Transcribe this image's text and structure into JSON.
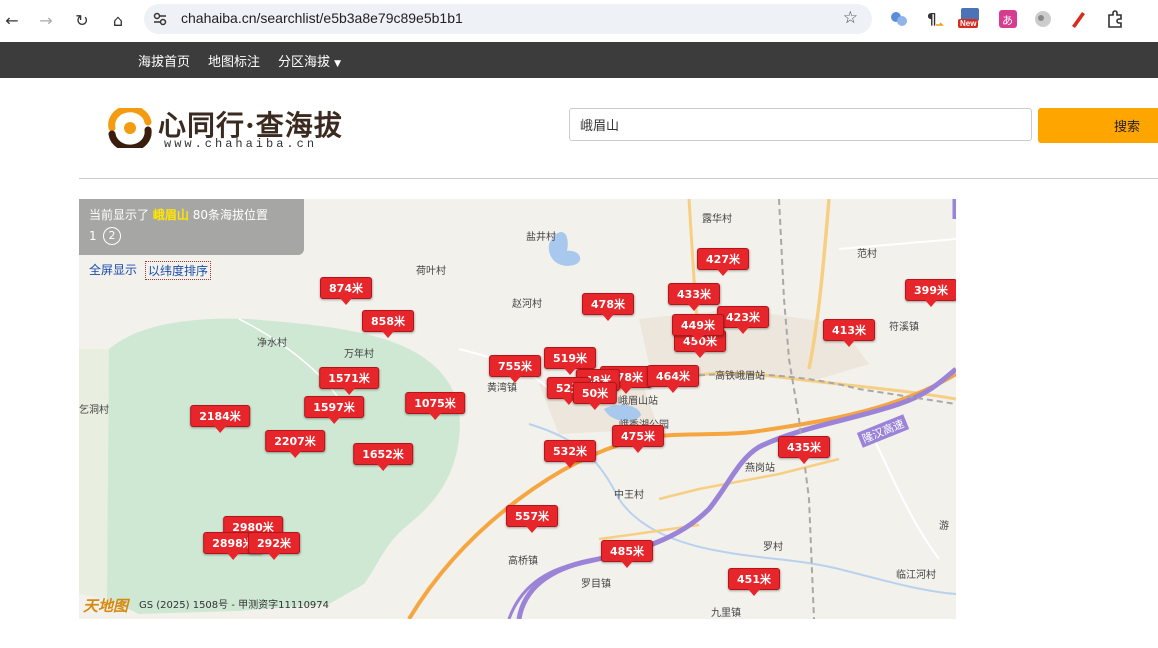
{
  "browser": {
    "url": "chahaiba.cn/searchlist/e5b3a8e79c89e5b1b1",
    "ext_badge": "New"
  },
  "site_nav": {
    "items": [
      "海拔首页",
      "地图标注",
      "分区海拔"
    ]
  },
  "header": {
    "logo_text": "心同行·查海拔",
    "logo_url": "www.chahaiba.cn",
    "search_value": "峨眉山",
    "search_button": "搜索"
  },
  "map": {
    "info": {
      "prefix": "当前显示了",
      "keyword": "峨眉山",
      "suffix": "80条海拔位置",
      "page1": "1",
      "page2": "2"
    },
    "links": {
      "fullscreen": "全屏显示",
      "sort": "以纬度排序"
    },
    "copyright": "GS (2025) 1508号 - 甲测资字11110974",
    "brand": "天地图",
    "place_labels": [
      "露华村",
      "盐井村",
      "荷叶村",
      "赵河村",
      "范村",
      "符溪镇",
      "净水村",
      "万年村",
      "高铁峨眉站",
      "黄湾镇",
      "峨眉山站",
      "燕岗站",
      "隆汉高速",
      "中王村",
      "高桥镇",
      "罗目镇",
      "罗村",
      "九里镇",
      "临江河村",
      "游",
      "乞洞村",
      "峨秀湖公园"
    ],
    "markers": [
      "427米",
      "433米",
      "423米",
      "413米",
      "399米",
      "478米",
      "450米",
      "874米",
      "858米",
      "755米",
      "519米",
      "478米",
      "464米",
      "1571米",
      "1597米",
      "1075米",
      "2184米",
      "2207米",
      "1652米",
      "532米",
      "475米",
      "435米",
      "557米",
      "485米",
      "451米",
      "2980米",
      "2898米",
      "292米",
      "449米",
      "48米",
      "52米",
      "50米"
    ]
  }
}
